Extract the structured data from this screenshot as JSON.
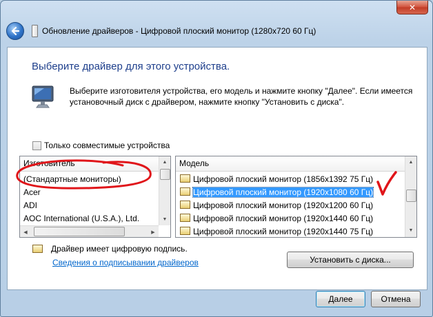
{
  "window": {
    "title": "Обновление драйверов - Цифровой плоский монитор (1280x720 60 Гц)",
    "close_glyph": "✕"
  },
  "heading": "Выберите драйвер для этого устройства.",
  "description": "Выберите изготовителя устройства, его модель и нажмите кнопку \"Далее\". Если имеется установочный диск с  драйвером, нажмите кнопку \"Установить с диска\".",
  "compatible_checkbox": {
    "label": "Только совместимые устройства",
    "checked": false
  },
  "manufacturer_list": {
    "header": "Изготовитель",
    "items": [
      "(Стандартные мониторы)",
      "Acer",
      "ADI",
      "AOC International (U.S.A.), Ltd."
    ]
  },
  "model_list": {
    "header": "Модель",
    "items": [
      "Цифровой плоский монитор (1856x1392 75 Гц)",
      "Цифровой плоский монитор (1920x1080 60 Гц)",
      "Цифровой плоский монитор (1920x1200 60 Гц)",
      "Цифровой плоский монитор (1920x1440 60 Гц)",
      "Цифровой плоский монитор (1920x1440 75 Гц)"
    ],
    "selected_index": 1
  },
  "signature": {
    "text": "Драйвер имеет цифровую подпись.",
    "link": "Сведения о подписывании драйверов"
  },
  "buttons": {
    "install_from_disk": "Установить с диска...",
    "next": "Далее",
    "cancel": "Отмена"
  },
  "colors": {
    "heading": "#1e3f8c",
    "link": "#0066cc",
    "selection": "#3399ff",
    "annotation": "#e0151a"
  }
}
